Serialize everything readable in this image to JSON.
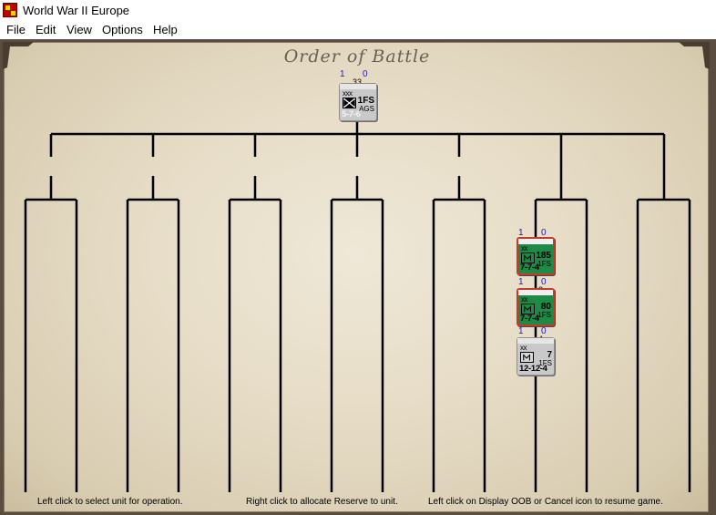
{
  "window": {
    "title": "World War II Europe"
  },
  "menu": {
    "items": [
      "File",
      "Edit",
      "View",
      "Options",
      "Help"
    ]
  },
  "oob": {
    "title": "Order of Battle",
    "root_unit": {
      "badge_left": "1",
      "badge_right": "0",
      "stack": "33",
      "echelon": "xxx",
      "name": "1FS",
      "sub": "AGS",
      "stats": "5-7-6"
    },
    "units": [
      {
        "badge_left": "1",
        "badge_right": "0",
        "stack": "",
        "echelon": "xx",
        "name": "185",
        "sub": "1FS",
        "stats": "7-7-4",
        "color": "green"
      },
      {
        "badge_left": "1",
        "badge_right": "0",
        "stack": "3",
        "echelon": "xx",
        "name": "80",
        "sub": "1FS",
        "stats": "7-7-4",
        "color": "green"
      },
      {
        "badge_left": "1",
        "badge_right": "0",
        "stack": "4",
        "echelon": "xx",
        "name": "7",
        "sub": "1FS",
        "stats": "12-12-4",
        "color": "grey"
      }
    ]
  },
  "instructions": {
    "left_click": "Left click to select unit for operation.",
    "right_click": "Right click to allocate Reserve to unit.",
    "resume": "Left click on Display OOB or Cancel icon to resume game."
  },
  "colors": {
    "frame": "#5a4c3e",
    "parchment": "#e6dcc6",
    "lines": "#000000",
    "green_counter": "#1e8a45",
    "counter_border_red": "#c73a2a",
    "badge_blue": "#1a1acc"
  }
}
